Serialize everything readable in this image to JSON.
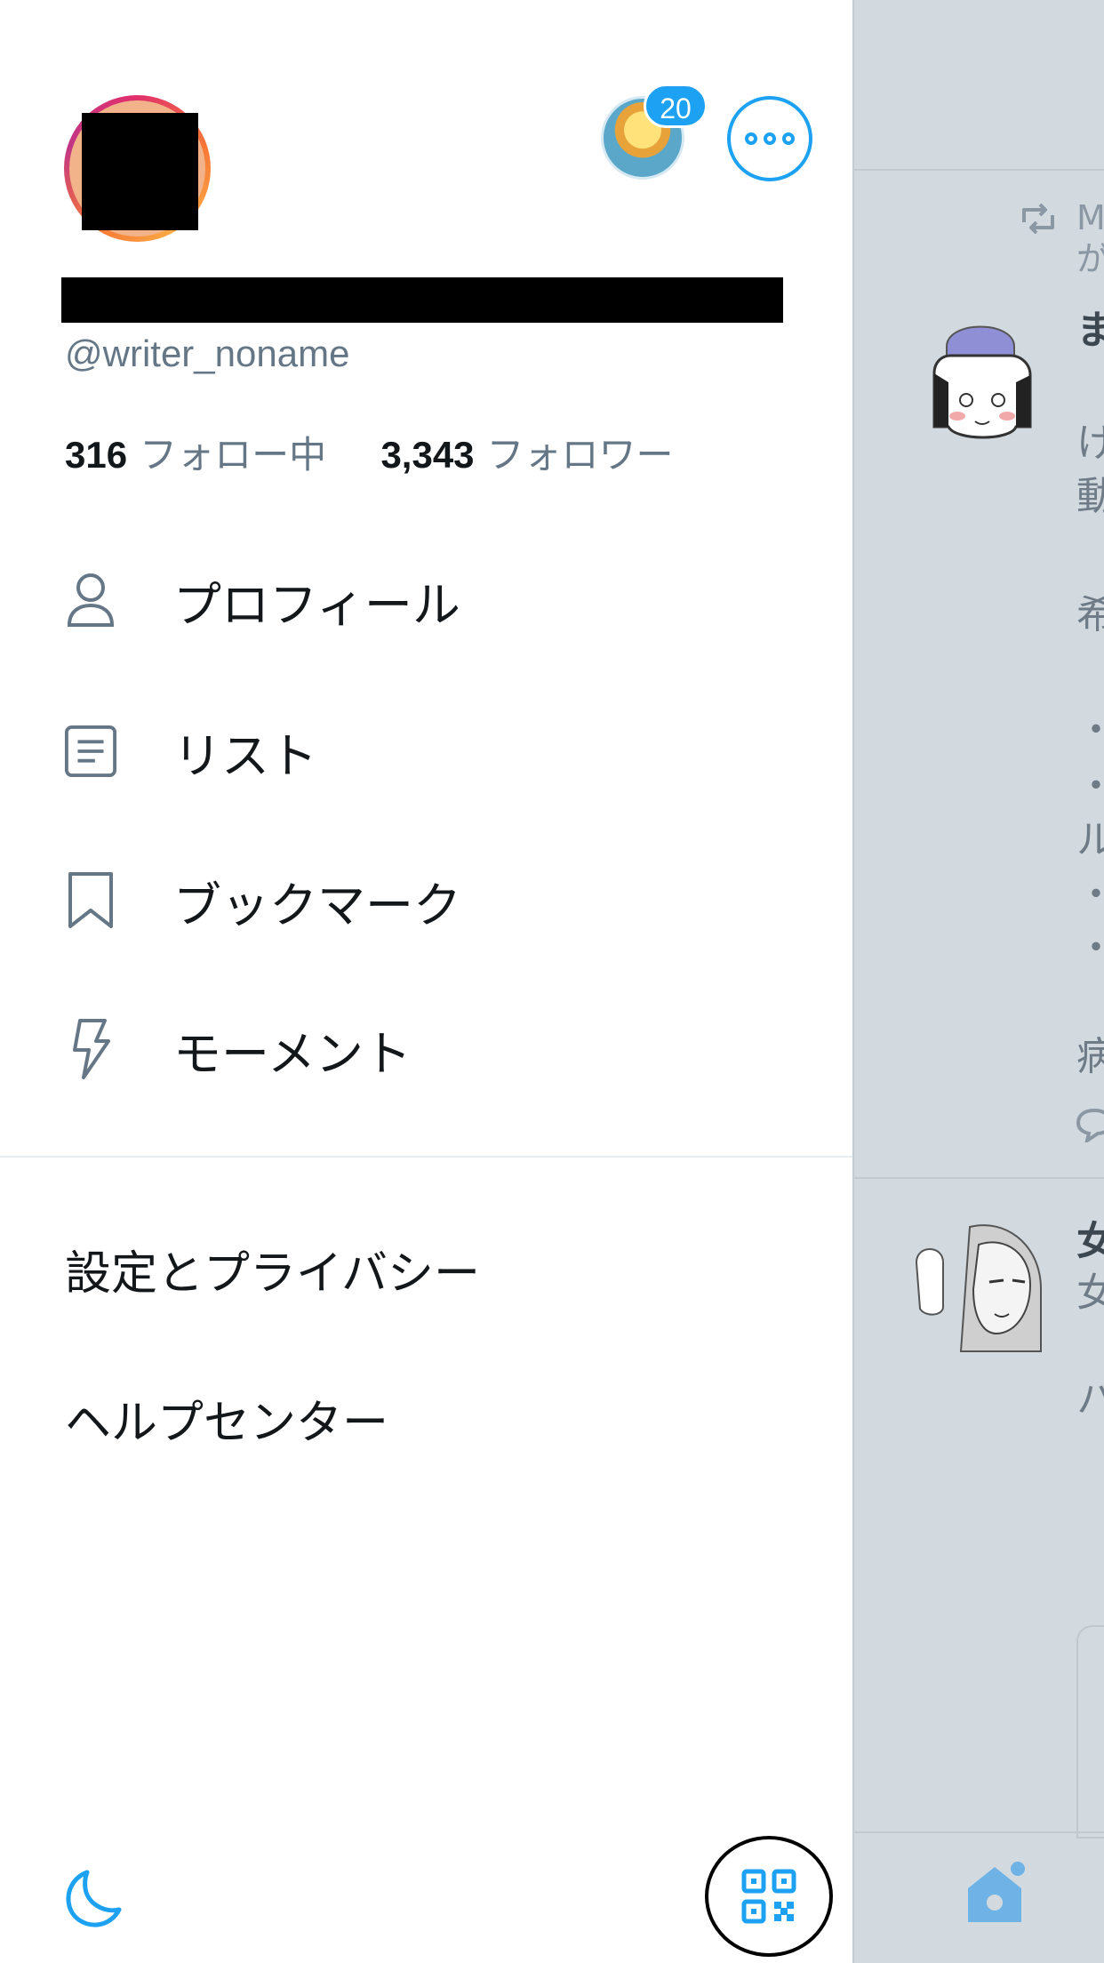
{
  "profile": {
    "handle": "@writer_noname",
    "following_count": "316",
    "following_label": "フォロー中",
    "followers_count": "3,343",
    "followers_label": "フォロワー"
  },
  "alt_account": {
    "badge_count": "20"
  },
  "menu": {
    "items": [
      {
        "label": "プロフィール",
        "icon": "person-icon"
      },
      {
        "label": "リスト",
        "icon": "list-icon"
      },
      {
        "label": "ブックマーク",
        "icon": "bookmark-icon"
      },
      {
        "label": "モーメント",
        "icon": "lightning-icon"
      }
    ],
    "secondary": [
      {
        "label": "設定とプライバシー"
      },
      {
        "label": "ヘルプセンター"
      }
    ]
  },
  "footer": {
    "night_mode_icon": "moon-icon",
    "qr_icon": "qr-code-icon"
  },
  "timeline_peek": {
    "retweet_text_line1": "M",
    "retweet_text_line2": "が",
    "tweet1_lines": [
      "ま",
      "け",
      "動",
      "希",
      "・",
      "・",
      "ル",
      "・",
      "・",
      "病"
    ],
    "tweet2_lines": [
      "女",
      "女",
      "ハ"
    ]
  },
  "colors": {
    "accent": "#1da1f2",
    "muted_text": "#657786",
    "primary_text": "#14171a",
    "divider": "#e6ecf0"
  }
}
